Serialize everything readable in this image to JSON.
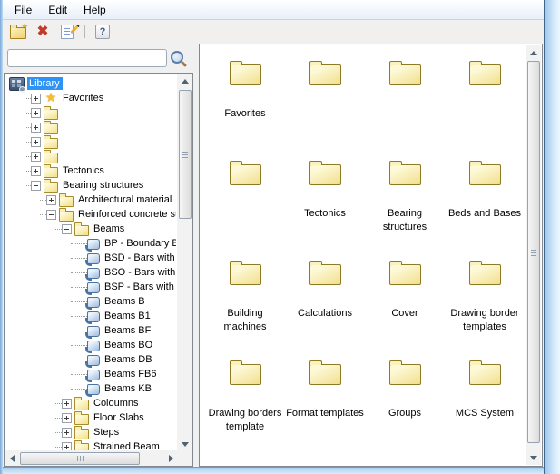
{
  "menu": {
    "items": [
      "File",
      "Edit",
      "Help"
    ]
  },
  "toolbar": {
    "buttons": [
      {
        "name": "new-folder"
      },
      {
        "name": "delete"
      },
      {
        "name": "edit"
      },
      {
        "name": "help"
      }
    ]
  },
  "search": {
    "value": "",
    "placeholder": ""
  },
  "tree": {
    "items": [
      {
        "label": "Library",
        "lvl": 0,
        "exp": "",
        "icon": "library",
        "sel": true
      },
      {
        "label": "Favorites",
        "lvl": 1,
        "exp": "+",
        "icon": "star",
        "sel": false
      },
      {
        "label": "",
        "lvl": 1,
        "exp": "+",
        "icon": "folder",
        "sel": false
      },
      {
        "label": "",
        "lvl": 1,
        "exp": "+",
        "icon": "folder",
        "sel": false
      },
      {
        "label": "",
        "lvl": 1,
        "exp": "+",
        "icon": "folder",
        "sel": false
      },
      {
        "label": "",
        "lvl": 1,
        "exp": "+",
        "icon": "folder",
        "sel": false
      },
      {
        "label": "Tectonics",
        "lvl": 1,
        "exp": "+",
        "icon": "folder",
        "sel": false
      },
      {
        "label": "Bearing structures",
        "lvl": 1,
        "exp": "-",
        "icon": "folder",
        "sel": false
      },
      {
        "label": "Architectural material",
        "lvl": 2,
        "exp": "+",
        "icon": "folder",
        "sel": false
      },
      {
        "label": "Reinforced concrete struct",
        "lvl": 2,
        "exp": "-",
        "icon": "folder",
        "sel": false
      },
      {
        "label": "Beams",
        "lvl": 3,
        "exp": "-",
        "icon": "folder",
        "sel": false
      },
      {
        "label": "BP - Boundary Bea",
        "lvl": 4,
        "exp": "",
        "icon": "block",
        "sel": false
      },
      {
        "label": "BSD - Bars with Tw",
        "lvl": 4,
        "exp": "",
        "icon": "block",
        "sel": false
      },
      {
        "label": "BSO - Bars with Sl",
        "lvl": 4,
        "exp": "",
        "icon": "block",
        "sel": false
      },
      {
        "label": "BSP - Bars with Pa",
        "lvl": 4,
        "exp": "",
        "icon": "block",
        "sel": false
      },
      {
        "label": "Beams B",
        "lvl": 4,
        "exp": "",
        "icon": "block",
        "sel": false
      },
      {
        "label": "Beams B1",
        "lvl": 4,
        "exp": "",
        "icon": "block",
        "sel": false
      },
      {
        "label": "Beams BF",
        "lvl": 4,
        "exp": "",
        "icon": "block",
        "sel": false
      },
      {
        "label": "Beams BO",
        "lvl": 4,
        "exp": "",
        "icon": "block",
        "sel": false
      },
      {
        "label": "Beams DB",
        "lvl": 4,
        "exp": "",
        "icon": "block",
        "sel": false
      },
      {
        "label": "Beams FB6",
        "lvl": 4,
        "exp": "",
        "icon": "block",
        "sel": false
      },
      {
        "label": "Beams KB",
        "lvl": 4,
        "exp": "",
        "icon": "block",
        "sel": false
      },
      {
        "label": "Coloumns",
        "lvl": 3,
        "exp": "+",
        "icon": "folder",
        "sel": false
      },
      {
        "label": "Floor Slabs",
        "lvl": 3,
        "exp": "+",
        "icon": "folder",
        "sel": false
      },
      {
        "label": "Steps",
        "lvl": 3,
        "exp": "+",
        "icon": "folder",
        "sel": false
      },
      {
        "label": "Strained Beam",
        "lvl": 3,
        "exp": "+",
        "icon": "folder",
        "sel": false
      }
    ]
  },
  "folders": {
    "items": [
      {
        "label": "Favorites"
      },
      {
        "label": ""
      },
      {
        "label": ""
      },
      {
        "label": ""
      },
      {
        "label": ""
      },
      {
        "label": "Tectonics"
      },
      {
        "label": "Bearing structures"
      },
      {
        "label": "Beds and Bases"
      },
      {
        "label": "Building machines"
      },
      {
        "label": "Calculations"
      },
      {
        "label": "Cover"
      },
      {
        "label": "Drawing border templates"
      },
      {
        "label": "Drawing borders template"
      },
      {
        "label": "Format templates"
      },
      {
        "label": "Groups"
      },
      {
        "label": "MCS System"
      }
    ]
  },
  "colors": {
    "selection": "#2f93f6",
    "window_border": "#9cc5e9",
    "folder_body": "#f1df8d",
    "delete_red": "#c0392b"
  }
}
